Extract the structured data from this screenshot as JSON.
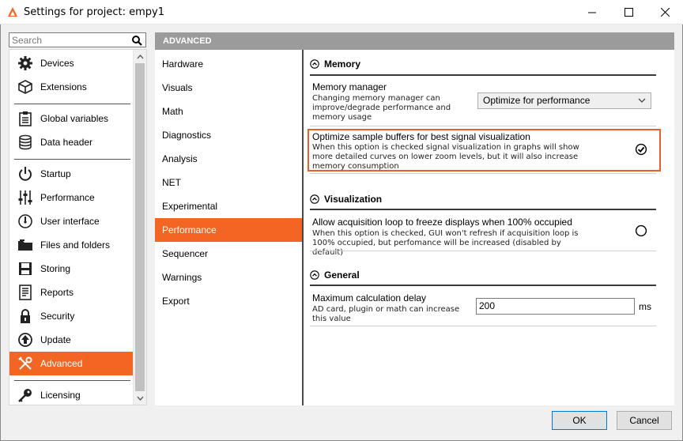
{
  "window": {
    "title": "Settings for project: empy1"
  },
  "search": {
    "placeholder": "Search"
  },
  "categories": [
    {
      "label": "Devices",
      "icon": "gear-icon"
    },
    {
      "label": "Extensions",
      "icon": "cube-icon"
    },
    {
      "label": "Global variables",
      "icon": "clipboard-icon"
    },
    {
      "label": "Data header",
      "icon": "database-icon"
    },
    {
      "label": "Startup",
      "icon": "power-icon"
    },
    {
      "label": "Performance",
      "icon": "sliders-icon"
    },
    {
      "label": "User interface",
      "icon": "gauge-icon"
    },
    {
      "label": "Files and folders",
      "icon": "folder-icon"
    },
    {
      "label": "Storing",
      "icon": "save-icon"
    },
    {
      "label": "Reports",
      "icon": "report-icon"
    },
    {
      "label": "Security",
      "icon": "lock-icon"
    },
    {
      "label": "Update",
      "icon": "update-icon"
    },
    {
      "label": "Advanced",
      "icon": "tools-icon",
      "active": true
    },
    {
      "label": "Licensing",
      "icon": "key-icon"
    }
  ],
  "section_header": "ADVANCED",
  "subcategories": [
    {
      "label": "Hardware"
    },
    {
      "label": "Visuals"
    },
    {
      "label": "Math"
    },
    {
      "label": "Diagnostics"
    },
    {
      "label": "Analysis"
    },
    {
      "label": "NET"
    },
    {
      "label": "Experimental"
    },
    {
      "label": "Performance",
      "active": true
    },
    {
      "label": "Sequencer"
    },
    {
      "label": "Warnings"
    },
    {
      "label": "Export"
    }
  ],
  "groups": {
    "memory": {
      "title": "Memory",
      "manager_title": "Memory manager",
      "manager_desc": "Changing memory manager can improve/degrade performance and memory usage",
      "manager_value": "Optimize for performance",
      "buffers_title": "Optimize sample buffers for best signal visualization",
      "buffers_desc": "When this option is checked signal visualization in graphs will show more detailed curves on lower zoom levels, but it will also increase memory consumption",
      "buffers_checked": true
    },
    "visualization": {
      "title": "Visualization",
      "freeze_title": "Allow acquisition loop to freeze displays when 100% occupied",
      "freeze_desc": "When this option is checked, GUI won't refresh if acquisition loop is 100% occupied, but perfomance will be increased (disabled by default)",
      "freeze_checked": false
    },
    "general": {
      "title": "General",
      "delay_title": "Maximum calculation delay",
      "delay_desc": "AD card, plugin or math can increase this value",
      "delay_value": "200",
      "delay_unit": "ms"
    }
  },
  "buttons": {
    "ok": "OK",
    "cancel": "Cancel"
  },
  "colors": {
    "accent": "#f26522",
    "highlight_border": "#e8612c",
    "header_bg": "#9b9b9b"
  }
}
